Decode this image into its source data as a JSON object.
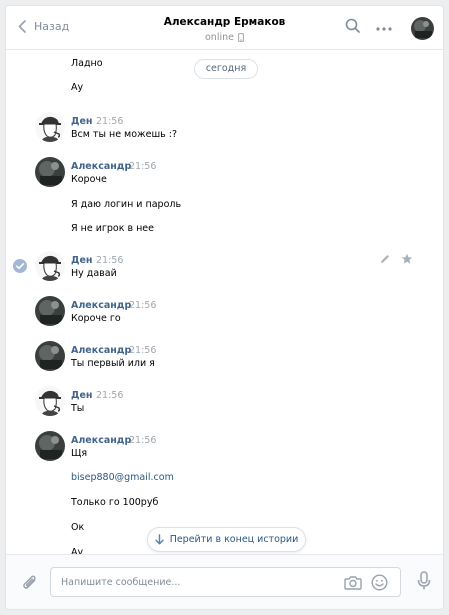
{
  "header": {
    "back_label": "Назад",
    "peer_name": "Александр Ермаков",
    "peer_status": "online"
  },
  "date_divider": "сегодня",
  "messages": [
    {
      "author": "",
      "time": "",
      "lines": [
        "Ладно",
        "Ау"
      ]
    },
    {
      "author": "Ден",
      "time": "21:56",
      "lines": [
        "Всм ты не можешь :?"
      ]
    },
    {
      "author": "Александр",
      "time": "21:56",
      "lines": [
        "Короче",
        "Я даю логин и пароль",
        "Я не игрок в нее"
      ]
    },
    {
      "author": "Ден",
      "time": "21:56",
      "lines": [
        "Ну давай"
      ],
      "selected": true
    },
    {
      "author": "Александр",
      "time": "21:56",
      "lines": [
        "Короче го"
      ]
    },
    {
      "author": "Александр",
      "time": "21:56",
      "lines": [
        "Ты первый или я"
      ]
    },
    {
      "author": "Ден",
      "time": "21:56",
      "lines": [
        "Ты"
      ]
    },
    {
      "author": "Александр",
      "time": "21:56",
      "lines": [
        "Щя",
        "bisep880@gmail.com",
        "Только го 100руб",
        "Ок",
        "Ау"
      ]
    }
  ],
  "goto_end_label": "Перейти в конец истории",
  "composer": {
    "placeholder": "Напишите сообщение..."
  },
  "icons": {
    "back": "chevron-left-icon",
    "search": "search-icon",
    "more": "more-icon",
    "phone": "mobile-phone-icon",
    "check": "check-icon",
    "edit": "pencil-icon",
    "star": "star-icon",
    "arrow_down": "arrow-down-icon",
    "attach": "paperclip-icon",
    "camera": "camera-icon",
    "smile": "smile-icon",
    "mic": "microphone-icon"
  },
  "colors": {
    "author": "#42648b",
    "link": "#2a5885",
    "muted": "#818c99",
    "border": "#dce1e6"
  }
}
